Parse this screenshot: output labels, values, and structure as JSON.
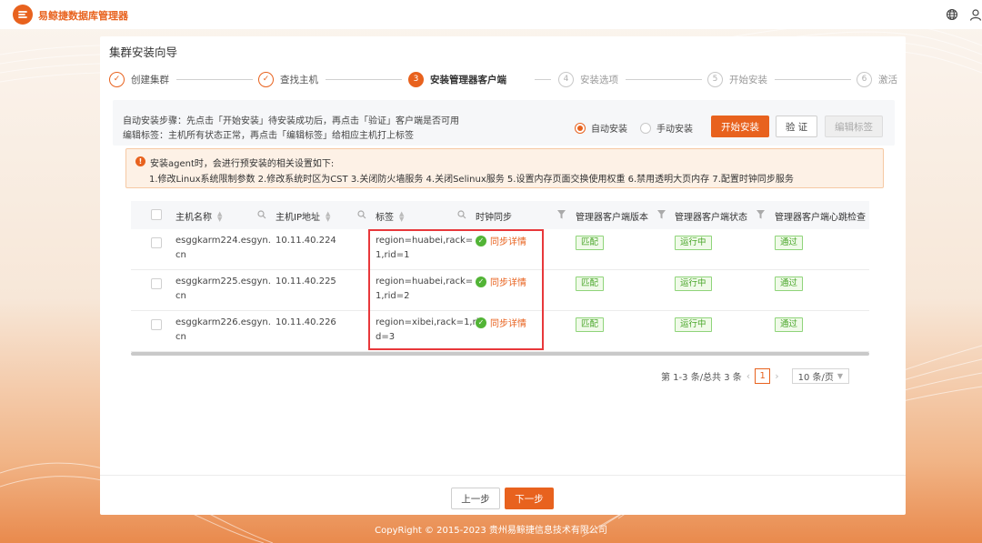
{
  "app": {
    "name": "易鲸捷数据库管理器",
    "copyright": "CopyRight © 2015-2023 贵州易鲸捷信息技术有限公司"
  },
  "colors": {
    "accent": "#e8621e",
    "success": "#52b436",
    "highlight_box": "#e8383b"
  },
  "header_icons": [
    "globe-icon",
    "user-icon"
  ],
  "wizard": {
    "title": "集群安装向导",
    "steps": [
      {
        "index": "1",
        "label": "创建集群",
        "state": "done"
      },
      {
        "index": "2",
        "label": "查找主机",
        "state": "done"
      },
      {
        "index": "3",
        "label": "安装管理器客户端",
        "state": "active"
      },
      {
        "index": "4",
        "label": "安装选项",
        "state": "todo"
      },
      {
        "index": "5",
        "label": "开始安装",
        "state": "todo"
      },
      {
        "index": "6",
        "label": "激活",
        "state": "todo"
      }
    ]
  },
  "instructions": {
    "line1": "自动安装步骤：先点击「开始安装」待安装成功后，再点击「验证」客户端是否可用",
    "line2": "编辑标签：主机所有状态正常，再点击「编辑标签」给相应主机打上标签",
    "radio_auto": "自动安装",
    "radio_manual": "手动安装",
    "selected": "auto",
    "btn_start": "开始安装",
    "btn_verify": "验 证",
    "btn_edit_tags": "编辑标签"
  },
  "notice": {
    "title": "安装agent时，会进行预安装的相关设置如下:",
    "body": "1.修改Linux系统限制参数 2.修改系统时区为CST 3.关闭防火墙服务 4.关闭Selinux服务 5.设置内存页面交换使用权重 6.禁用透明大页内存 7.配置时钟同步服务"
  },
  "table": {
    "columns": {
      "hostname": "主机名称",
      "ip": "主机IP地址",
      "tags": "标签",
      "clock_sync": "时钟同步",
      "client_version": "管理器客户端版本",
      "client_status": "管理器客户端状态",
      "heartbeat": "管理器客户端心跳检查"
    },
    "rows": [
      {
        "hostname_1": "esggkarm224.esgyn.",
        "hostname_2": "cn",
        "ip": "10.11.40.224",
        "tags_1": "region=huabei,rack=",
        "tags_2": "1,rid=1",
        "sync": "同步详情",
        "version": "匹配",
        "status": "运行中",
        "heartbeat": "通过"
      },
      {
        "hostname_1": "esggkarm225.esgyn.",
        "hostname_2": "cn",
        "ip": "10.11.40.225",
        "tags_1": "region=huabei,rack=",
        "tags_2": "1,rid=2",
        "sync": "同步详情",
        "version": "匹配",
        "status": "运行中",
        "heartbeat": "通过"
      },
      {
        "hostname_1": "esggkarm226.esgyn.",
        "hostname_2": "cn",
        "ip": "10.11.40.226",
        "tags_1": "region=xibei,rack=1,ri",
        "tags_2": "d=3",
        "sync": "同步详情",
        "version": "匹配",
        "status": "运行中",
        "heartbeat": "通过"
      }
    ]
  },
  "pagination": {
    "summary": "第 1-3 条/总共 3 条",
    "current": "1",
    "page_size": "10 条/页"
  },
  "footer": {
    "prev": "上一步",
    "next": "下一步"
  }
}
